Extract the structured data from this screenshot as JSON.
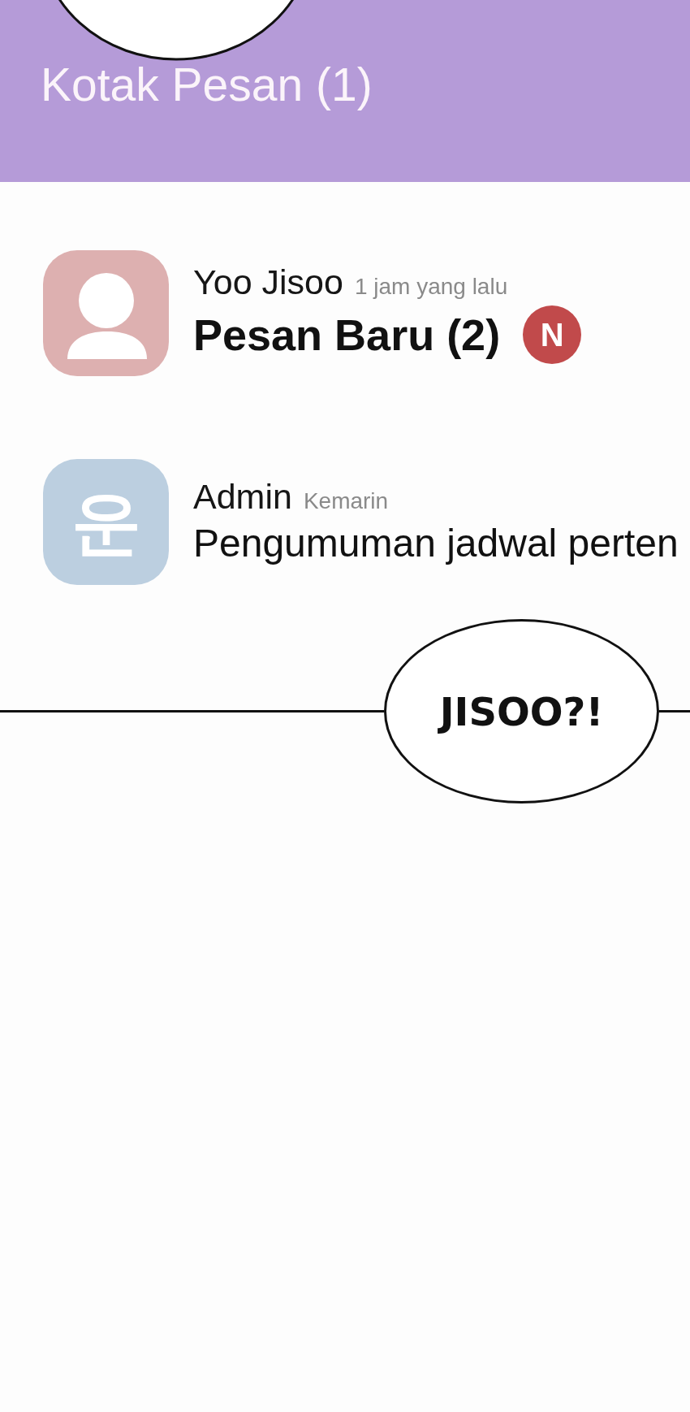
{
  "header": {
    "title": "Kotak Pesan (1)"
  },
  "messages": [
    {
      "sender": "Yoo Jisoo",
      "time": "1 jam yang lalu",
      "text": "Pesan Baru (2)",
      "unread": true,
      "badge": "N",
      "avatar": {
        "kind": "person",
        "color": "#ddb0b0"
      }
    },
    {
      "sender": "Admin",
      "time": "Kemarin",
      "text": "Pengumuman jadwal perten",
      "unread": false,
      "avatar": {
        "kind": "letter",
        "letter": "운",
        "color": "#bccfe0"
      }
    }
  ],
  "speech_bubble": {
    "text": "JISOO?!"
  }
}
